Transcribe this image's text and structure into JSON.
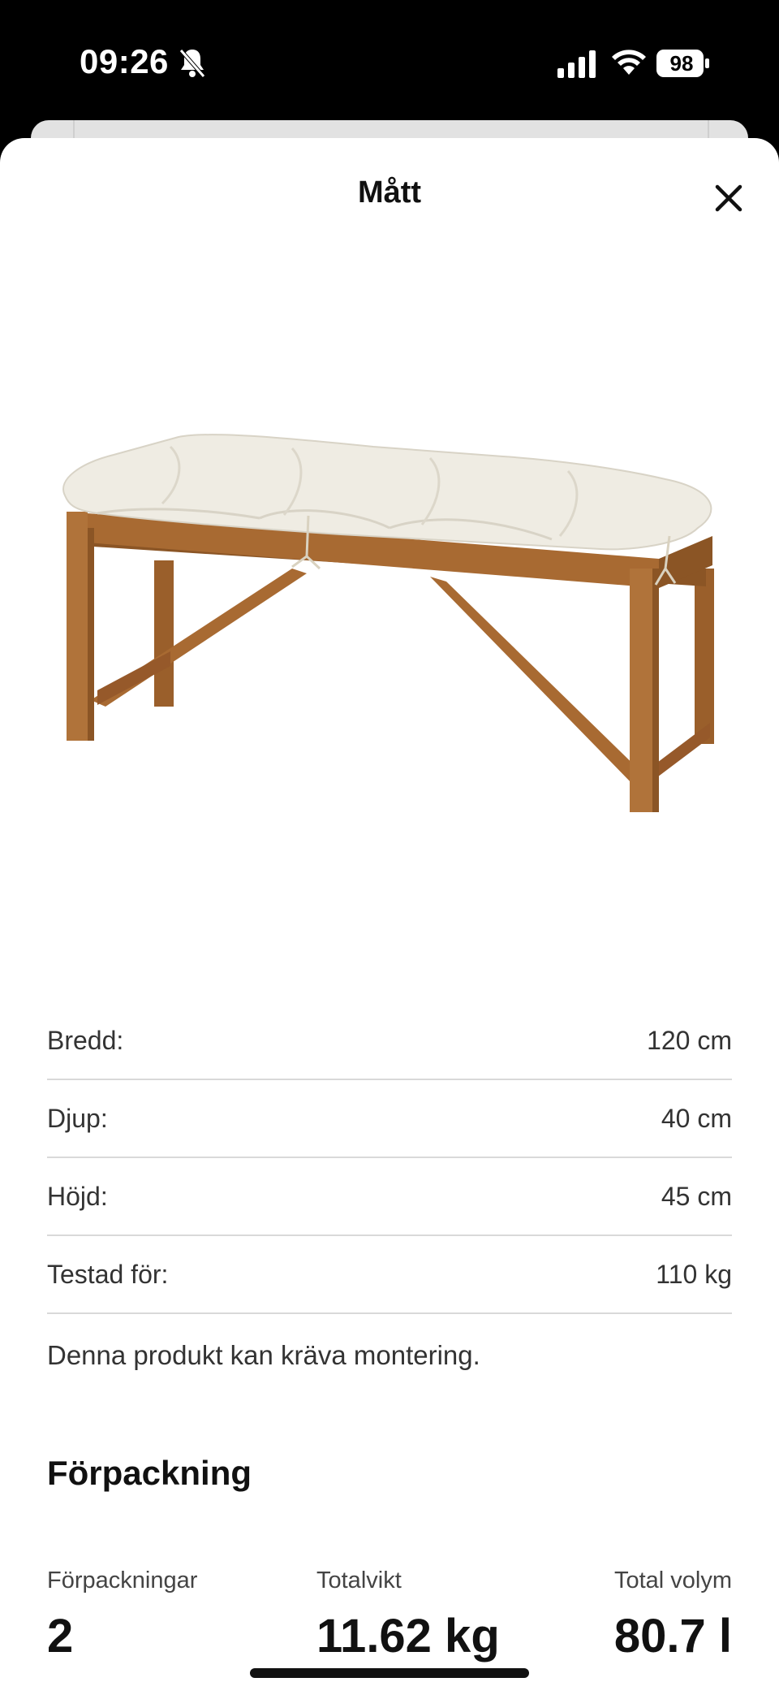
{
  "status_bar": {
    "time": "09:26",
    "battery_level": "98"
  },
  "header": {
    "title": "Mått",
    "close_icon": "close-icon"
  },
  "dimensions": [
    {
      "label": "Bredd:",
      "value": "120 cm"
    },
    {
      "label": "Djup:",
      "value": "40 cm"
    },
    {
      "label": "Höjd:",
      "value": "45 cm"
    },
    {
      "label": "Testad för:",
      "value": "110 kg"
    }
  ],
  "assembly_note": "Denna produkt kan kräva montering.",
  "packaging": {
    "title": "Förpackning",
    "count_label": "Förpackningar",
    "count_value": "2",
    "weight_label": "Totalvikt",
    "weight_value": "11.62 kg",
    "volume_label": "Total volym",
    "volume_value": "80.7 l"
  },
  "colors": {
    "wood": "#a86a32",
    "wood_dark": "#8b5525",
    "cushion": "#efece3",
    "divider": "#d9d9d9"
  }
}
